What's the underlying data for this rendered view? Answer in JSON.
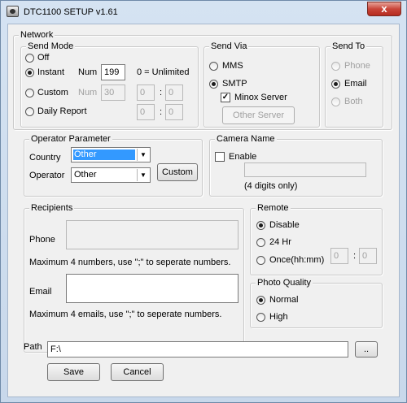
{
  "window": {
    "title": "DTC1100 SETUP v1.61",
    "close_glyph": "x"
  },
  "network": {
    "legend": "Network",
    "send_mode": {
      "legend": "Send Mode",
      "off": "Off",
      "instant": "Instant",
      "custom": "Custom",
      "daily_report": "Daily Report",
      "num_label": "Num",
      "instant_num": "199",
      "unlimited_note": "0 = Unlimited",
      "custom_num": "30",
      "custom_hour": "0",
      "custom_min": "0",
      "daily_hour": "0",
      "daily_min": "0",
      "colon": ":"
    },
    "send_via": {
      "legend": "Send Via",
      "mms": "MMS",
      "smtp": "SMTP",
      "minox_server": "Minox Server",
      "other_server": "Other Server",
      "check_glyph": "✓"
    },
    "send_to": {
      "legend": "Send To",
      "phone": "Phone",
      "email": "Email",
      "both": "Both"
    }
  },
  "operator": {
    "legend": "Operator Parameter",
    "country_label": "Country",
    "country_value": "Other",
    "operator_label": "Operator",
    "operator_value": "Other",
    "custom_button": "Custom",
    "arrow_glyph": "▼"
  },
  "camera_name": {
    "legend": "Camera Name",
    "enable": "Enable",
    "name_value": "",
    "hint": "(4 digits only)"
  },
  "recipients": {
    "legend": "Recipients",
    "phone_label": "Phone",
    "phone_value": "",
    "phone_note": "Maximum 4 numbers, use \";\" to seperate numbers.",
    "email_label": "Email",
    "email_value": "",
    "email_note": "Maximum 4 emails, use \";\" to seperate numbers."
  },
  "remote": {
    "legend": "Remote",
    "disable": "Disable",
    "hr24": "24 Hr",
    "once": "Once(hh:mm)",
    "once_hour": "0",
    "once_min": "0",
    "colon": ":"
  },
  "photo_quality": {
    "legend": "Photo Quality",
    "normal": "Normal",
    "high": "High"
  },
  "path": {
    "label": "Path",
    "value": "F:\\",
    "browse": ".."
  },
  "actions": {
    "save": "Save",
    "cancel": "Cancel"
  }
}
